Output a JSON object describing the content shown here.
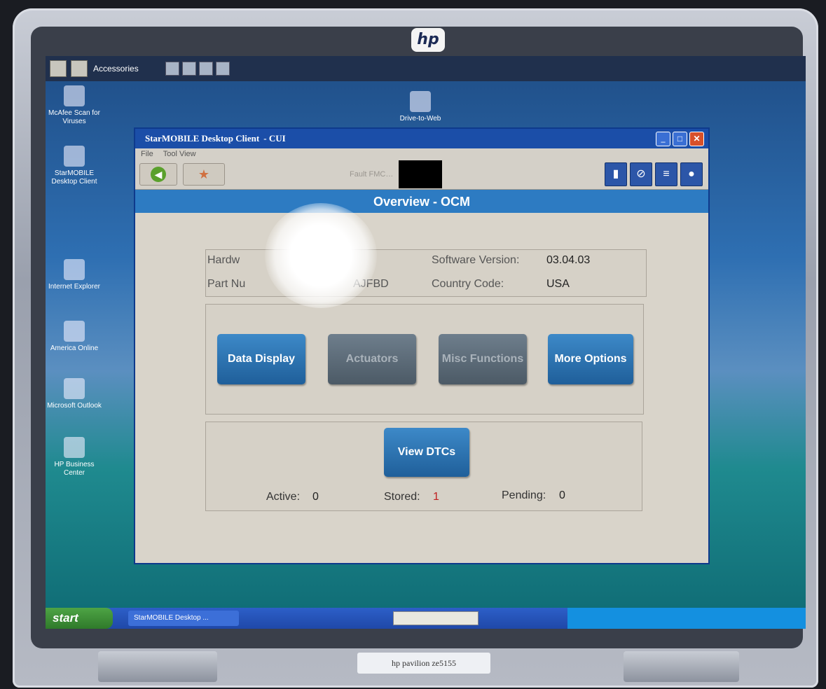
{
  "device": {
    "brand_logo": "hp",
    "model_label": "hp pavilion ze5155"
  },
  "desktop": {
    "top_toolbar": {
      "label": "Accessories"
    },
    "icons": [
      {
        "label": "McAfee Scan for Viruses"
      },
      {
        "label": "StarMOBILE Desktop Client"
      },
      {
        "label": "Internet Explorer"
      },
      {
        "label": "America Online"
      },
      {
        "label": "Microsoft Outlook"
      },
      {
        "label": "HP Business Center"
      },
      {
        "label": "Drive-to-Web"
      }
    ]
  },
  "window": {
    "title": "StarMOBILE Desktop Client",
    "title_suffix": "- CUI",
    "menu": [
      "File",
      "Tool View"
    ],
    "toolbar_text": "Fault FMC…",
    "status_icons": [
      "battery-icon",
      "no-connection-icon",
      "network-icon",
      "plug-icon"
    ]
  },
  "screen": {
    "header": "Overview - OCM",
    "info": {
      "hardware_label": "Hardw",
      "part_label": "Part Nu",
      "part_value": "AJFBD",
      "software_label": "Software Version:",
      "software_value": "03.04.03",
      "country_label": "Country Code:",
      "country_value": "USA"
    },
    "buttons": {
      "data_display": "Data Display",
      "actuators": "Actuators",
      "misc_functions": "Misc Functions",
      "more_options": "More Options",
      "view_dtcs": "View DTCs"
    },
    "dtc": {
      "active_label": "Active:",
      "active_value": "0",
      "stored_label": "Stored:",
      "stored_value": "1",
      "pending_label": "Pending:",
      "pending_value": "0"
    }
  },
  "taskbar": {
    "start": "start",
    "task": "StarMOBILE Desktop ..."
  },
  "colors": {
    "title_bar": "#1b4ea8",
    "header_bar": "#2d7bc2",
    "button_blue": "#2f74b4",
    "button_disabled": "#5c6a76",
    "stored_value": "#c02020"
  }
}
